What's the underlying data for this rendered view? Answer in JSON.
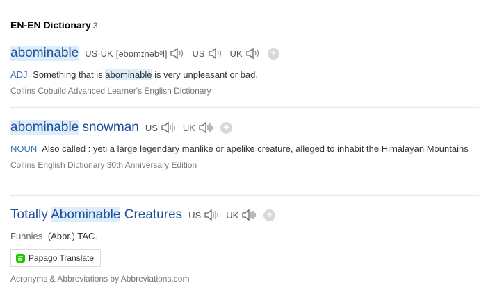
{
  "section": {
    "title": "EN-EN Dictionary",
    "count": "3"
  },
  "entries": [
    {
      "headword": "abominable",
      "pron_label": "US·UK",
      "pron_ipa": "[əbɒmɪnəbᵊl]",
      "us_label": "US",
      "uk_label": "UK",
      "pos": "ADJ",
      "def_before": "Something that is ",
      "def_highlight": "abominable",
      "def_after": " is very unpleasant or bad.",
      "source": "Collins Cobuild Advanced Learner's English Dictionary"
    },
    {
      "headword_part1": "abominable",
      "headword_part2": " snowman",
      "us_label": "US",
      "uk_label": "UK",
      "pos": "NOUN",
      "definition": "Also called : yeti a large legendary manlike or apelike creature, alleged to inhabit the Himalayan Mountains",
      "source": "Collins English Dictionary 30th Anniversary Edition"
    },
    {
      "headword_part1": "Totally ",
      "headword_part2": "Abominable",
      "headword_part3": " Creatures",
      "us_label": "US",
      "uk_label": "UK",
      "pos": "Funnies",
      "definition": "(Abbr.) TAC.",
      "translate_label": "Papago Translate",
      "source": "Acronyms & Abbreviations by Abbreviations.com"
    }
  ],
  "icons": {
    "speaker": "speaker-icon",
    "add": "plus-circle-icon",
    "papago": "papago-logo-icon"
  },
  "colors": {
    "headword": "#1f4e9c",
    "highlight": "#ddeefa",
    "pos": "#3b6fb6",
    "papago_green": "#1ec800"
  }
}
